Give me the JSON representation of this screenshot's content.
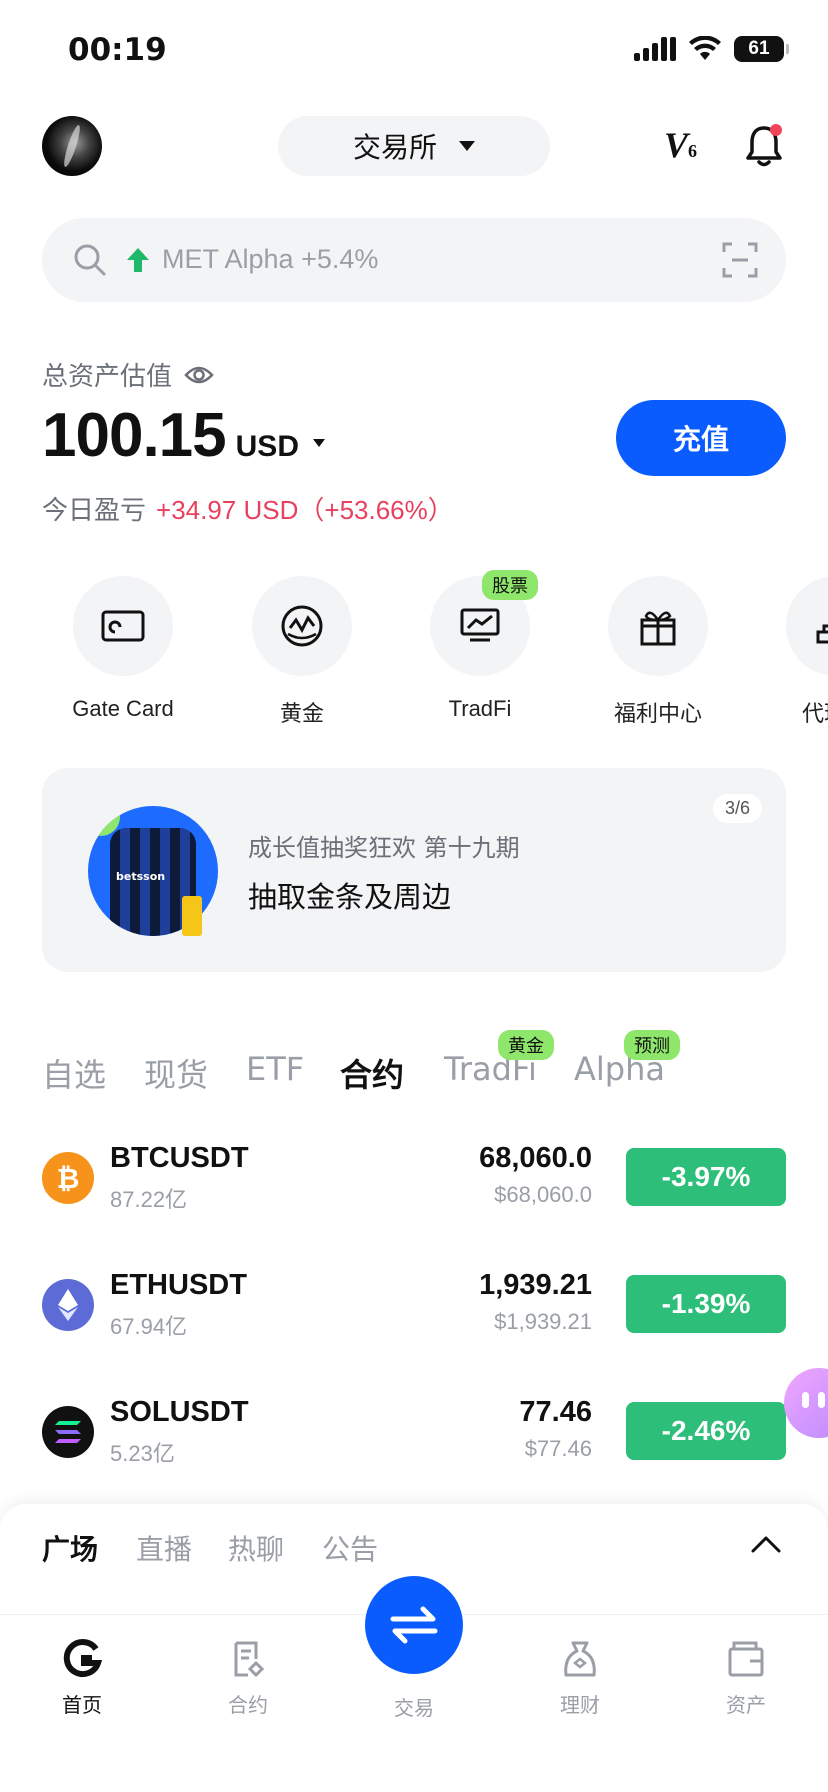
{
  "status_bar": {
    "time": "00:19",
    "battery": "61"
  },
  "header": {
    "exchange_label": "交易所",
    "vip_label": "V",
    "vip_level": "6"
  },
  "search": {
    "placeholder": "MET Alpha +5.4%"
  },
  "assets": {
    "title": "总资产估值",
    "value": "100.15",
    "currency": "USD",
    "deposit_label": "充值",
    "pnl_label": "今日盈亏",
    "pnl_value": "+34.97 USD（+53.66%）"
  },
  "shortcuts": [
    {
      "label": "Gate Card",
      "icon": "card-icon"
    },
    {
      "label": "黄金",
      "icon": "gold-globe-icon"
    },
    {
      "label": "TradFi",
      "icon": "chart-board-icon",
      "tag": "股票"
    },
    {
      "label": "福利中心",
      "icon": "gift-icon"
    },
    {
      "label": "代理",
      "icon": "network-icon"
    }
  ],
  "banner": {
    "subtitle": "成长值抽奖狂欢 第十九期",
    "title": "抽取金条及周边",
    "page": "3/6",
    "jersey_text": "betsson"
  },
  "market_tabs": [
    {
      "label": "自选"
    },
    {
      "label": "现货"
    },
    {
      "label": "ETF"
    },
    {
      "label": "合约",
      "active": true
    },
    {
      "label": "TradFi",
      "tag": "黄金"
    },
    {
      "label": "Alpha",
      "tag": "预测"
    }
  ],
  "market_rows": [
    {
      "pair": "BTCUSDT",
      "volume": "87.22亿",
      "price": "68,060.0",
      "price_fiat": "$68,060.0",
      "change": "-3.97%",
      "icon": "btc-icon",
      "icon_color": "#f7931a"
    },
    {
      "pair": "ETHUSDT",
      "volume": "67.94亿",
      "price": "1,939.21",
      "price_fiat": "$1,939.21",
      "change": "-1.39%",
      "icon": "eth-icon",
      "icon_color": "#5c6bd6"
    },
    {
      "pair": "SOLUSDT",
      "volume": "5.23亿",
      "price": "77.46",
      "price_fiat": "$77.46",
      "change": "-2.46%",
      "icon": "sol-icon",
      "icon_color": "#111111"
    }
  ],
  "community_tabs": [
    {
      "label": "广场",
      "active": true
    },
    {
      "label": "直播"
    },
    {
      "label": "热聊"
    },
    {
      "label": "公告"
    }
  ],
  "bottom_nav": [
    {
      "label": "首页",
      "icon": "home-icon",
      "active": true
    },
    {
      "label": "合约",
      "icon": "futures-icon"
    },
    {
      "label": "交易",
      "icon": "swap-icon"
    },
    {
      "label": "理财",
      "icon": "earn-icon"
    },
    {
      "label": "资产",
      "icon": "wallet-icon"
    }
  ],
  "colors": {
    "accent": "#0a5cff",
    "up": "#e8415f",
    "down_badge": "#2dbf79",
    "tag_green": "#8ee66a"
  }
}
